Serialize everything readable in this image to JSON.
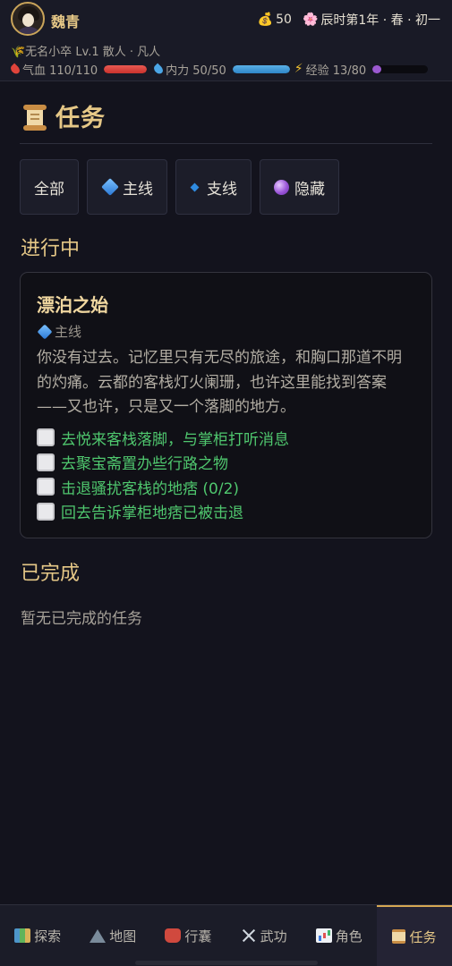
{
  "player": {
    "name": "魏青",
    "sub_line": "🌾无名小卒 Lv.1 散人 · 凡人"
  },
  "currency": {
    "money": "50",
    "date": "辰时第1年 · 春 · 初一"
  },
  "stats": {
    "hp_label": "气血 110/110",
    "hp_fraction": 1.0,
    "mp_label": "内力 50/50",
    "mp_fraction": 1.0,
    "xp_label": "经验 13/80",
    "xp_fraction": 0.1625
  },
  "page": {
    "title": "任务"
  },
  "filters": [
    {
      "label": "全部"
    },
    {
      "label": "主线"
    },
    {
      "label": "支线"
    },
    {
      "label": "隐藏"
    }
  ],
  "in_progress": {
    "heading": "进行中",
    "quests": [
      {
        "name": "漂泊之始",
        "tag": "主线",
        "description": "你没有过去。记忆里只有无尽的旅途，和胸口那道不明的灼痛。云都的客栈灯火阑珊，也许这里能找到答案——又也许，只是又一个落脚的地方。",
        "objectives": [
          "去悦来客栈落脚，与掌柜打听消息",
          "去聚宝斋置办些行路之物",
          "击退骚扰客栈的地痞 (0/2)",
          "回去告诉掌柜地痞已被击退"
        ]
      }
    ]
  },
  "completed": {
    "heading": "已完成",
    "empty_text": "暂无已完成的任务"
  },
  "nav": {
    "items": [
      {
        "label": "探索",
        "icon": "map-icon"
      },
      {
        "label": "地图",
        "icon": "mountain-icon"
      },
      {
        "label": "行囊",
        "icon": "backpack-icon"
      },
      {
        "label": "武功",
        "icon": "crossed-swords-icon"
      },
      {
        "label": "角色",
        "icon": "bar-chart-icon"
      },
      {
        "label": "任务",
        "icon": "scroll-icon"
      }
    ],
    "active_index": 5
  },
  "colors": {
    "accent_gold": "#e6c887",
    "objective_green": "#4fc76e",
    "hp_red": "#c9322d",
    "mp_blue": "#2f86c8",
    "xp_purple": "#9b59d0"
  }
}
